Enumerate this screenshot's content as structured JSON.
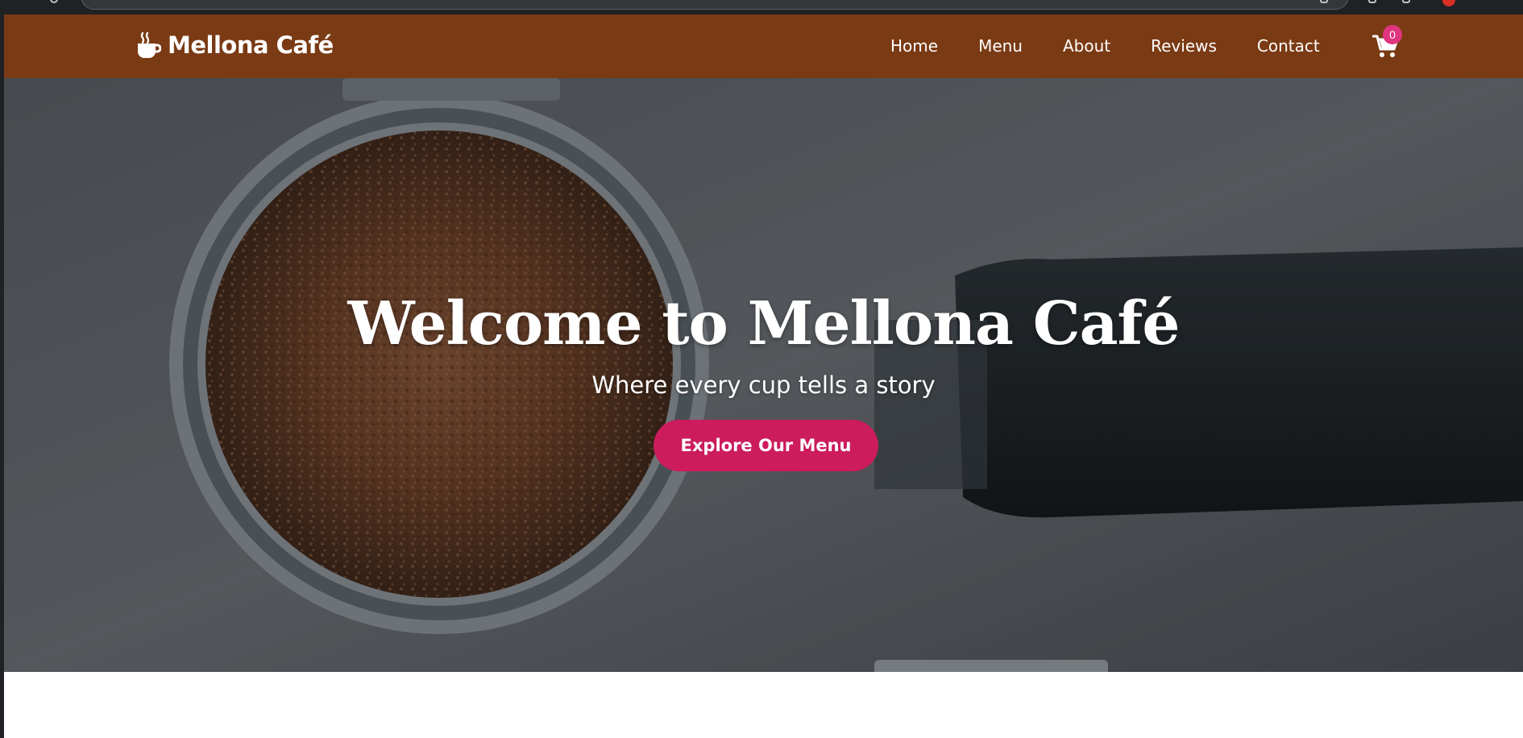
{
  "brand": {
    "name": "Mellona Café",
    "icon": "coffee-cup-icon",
    "color": "#7a3a14"
  },
  "nav": {
    "items": [
      {
        "label": "Home"
      },
      {
        "label": "Menu"
      },
      {
        "label": "About"
      },
      {
        "label": "Reviews"
      },
      {
        "label": "Contact"
      }
    ],
    "cart": {
      "icon": "shopping-cart-icon",
      "count": "0",
      "badge_color": "#e0357f"
    }
  },
  "hero": {
    "title": "Welcome to Mellona Café",
    "subtitle": "Where every cup tells a story",
    "cta_label": "Explore Our Menu",
    "cta_color": "#cc1c5b"
  }
}
